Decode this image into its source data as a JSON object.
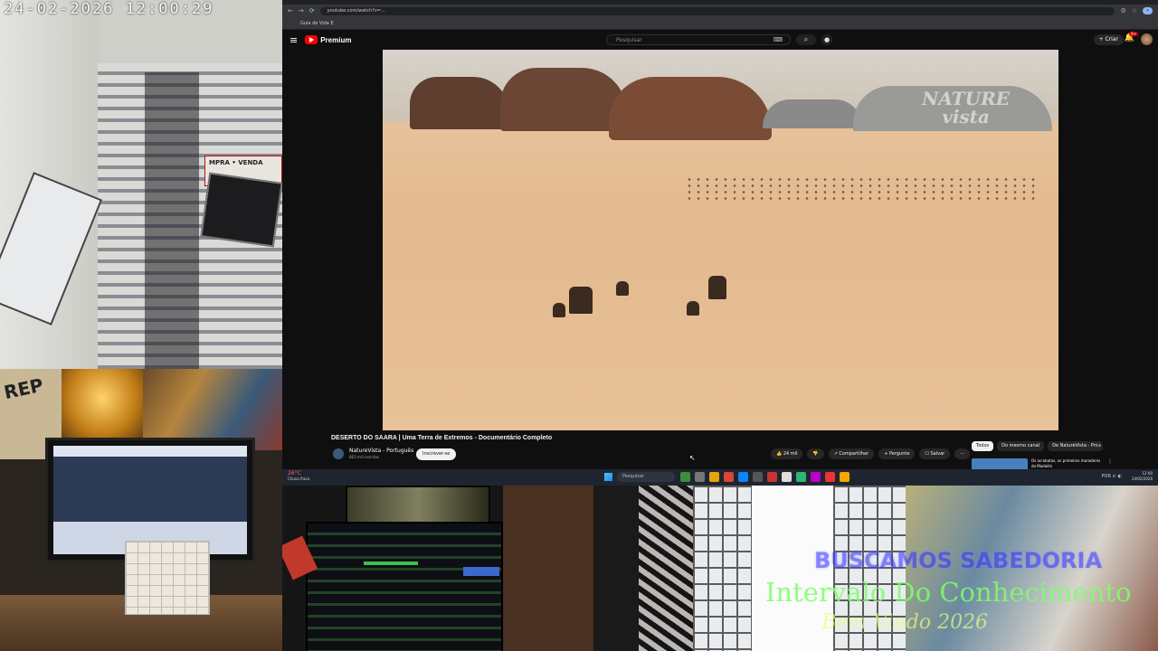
{
  "cam_top_left": {
    "timestamp": "24-02-2026  12:00:29",
    "sign_text": "MPRA • VENDA"
  },
  "browser": {
    "url": "youtube.com/watch?v=...",
    "bookmark": "Guia de Vida E"
  },
  "youtube": {
    "logo": "Premium",
    "search_placeholder": "Pesquisar",
    "create_label": "+ Criar",
    "notifications": "9+",
    "video_title": "DESERTO DO SAARA | Uma Terra de Extremos - Documentário Completo",
    "watermark_line1": "NATURE",
    "watermark_line2": "vista",
    "channel_name": "NatureVista - Português",
    "channel_subs": "663 mil inscritos",
    "subscribe_label": "Inscrever-se",
    "actions": {
      "like": "👍 24 mil",
      "dislike": "👎",
      "share": "↗ Compartilhar",
      "save": "+ Pergunte",
      "more": "☐ Salvar",
      "dots": "⋯"
    },
    "chips": [
      "Todos",
      "Do mesmo canal",
      "De NatureVista - Pro"
    ],
    "recommended_title": "Os acrobatas, os primeiros moradores do Madalén"
  },
  "taskbar": {
    "weather_temp": "26°C",
    "weather_desc": "Chuva fraca",
    "search_label": "Pesquisar",
    "tray_time": "12:00",
    "tray_date": "24/02/2026",
    "tray_lang": "POR"
  },
  "cam_bottom_left": {
    "poster_text": "REP"
  },
  "overlay": {
    "line1": "BUSCAMOS SABEDORIA",
    "line2": "Intervalo Do Conhecimento",
    "line3": "Bem Vindo 2026"
  },
  "colors": {
    "youtube_red": "#ff0000",
    "overlay_blue": "#3838ff",
    "overlay_green": "#7dff6a",
    "overlay_yellow": "#e6ff7a"
  }
}
